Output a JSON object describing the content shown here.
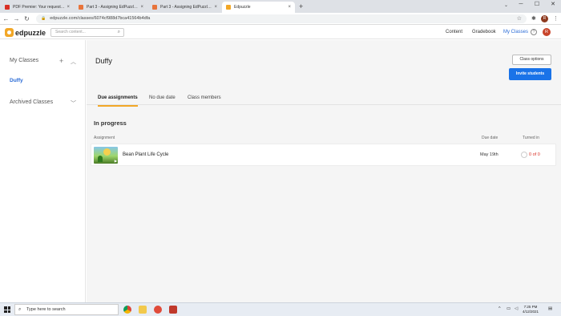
{
  "browser": {
    "tabs": [
      {
        "label": "PDF Premier: Your request for 2...",
        "color": "#d93025"
      },
      {
        "label": "Part 3 - Assigning EdPuzzle to U...",
        "color": "#e8743b"
      },
      {
        "label": "Part 3 - Assigning EdPuzzle to U...",
        "color": "#e8743b"
      },
      {
        "label": "Edpuzzle",
        "color": "#f2a727"
      }
    ],
    "new_tab": "+",
    "url": "edpuzzle.com/classes/6074cf988d7bca41564b4dfa"
  },
  "app": {
    "logo_text": "edpuzzle",
    "search_placeholder": "Search content...",
    "nav": {
      "content": "Content",
      "gradebook": "Gradebook",
      "my_classes": "My Classes"
    },
    "user_initial": "R",
    "help": "?"
  },
  "sidebar": {
    "my_classes": "My Classes",
    "add": "+",
    "classes": [
      "Duffy"
    ],
    "archived": "Archived Classes"
  },
  "main": {
    "class_name": "Duffy",
    "class_options": "Class options",
    "invite": "Invite students",
    "tabs": [
      "Due assignments",
      "No due date",
      "Class members"
    ],
    "section_title": "In progress",
    "columns": {
      "assignment": "Assignment",
      "due": "Due date",
      "turned": "Turned in"
    },
    "rows": [
      {
        "title": "Bean Plant Life Cycle",
        "due": "May 19th",
        "turned_in": "0 of 0"
      }
    ]
  },
  "taskbar": {
    "search_placeholder": "Type here to search",
    "time": "7:25 PM",
    "date": "4/12/2021"
  },
  "colors": {
    "accent": "#1a73e8",
    "brand": "#f2a727",
    "alert": "#d93025"
  }
}
